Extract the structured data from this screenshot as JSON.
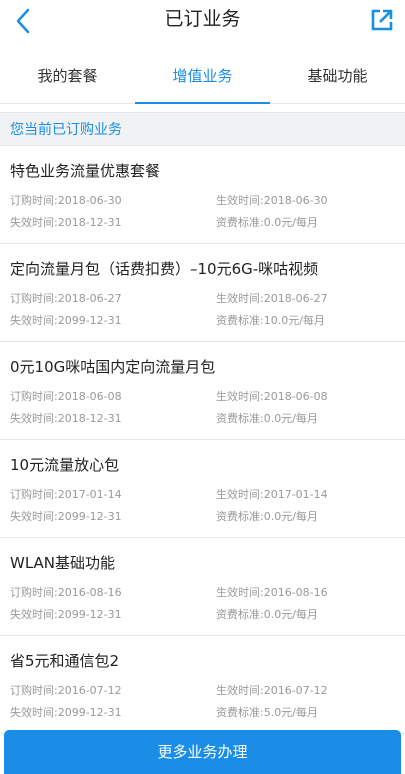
{
  "header": {
    "title": "已订业务",
    "back_icon": "chevron-left-icon",
    "share_icon": "external-link-icon",
    "accent": "#1a8ee6"
  },
  "tabs": [
    {
      "label": "我的套餐",
      "active": false
    },
    {
      "label": "增值业务",
      "active": true
    },
    {
      "label": "基础功能",
      "active": false
    }
  ],
  "section": {
    "label": "您当前已订购业务"
  },
  "items": [
    {
      "title": "特色业务流量优惠套餐",
      "order_time": "订购时间:2018-06-30",
      "effective_time": "生效时间:2018-06-30",
      "expire_time": "失效时间:2018-12-31",
      "fee": "资费标准:0.0元/每月"
    },
    {
      "title": "定向流量月包（话费扣费）–10元6G-咪咕视频",
      "order_time": "订购时间:2018-06-27",
      "effective_time": "生效时间:2018-06-27",
      "expire_time": "失效时间:2099-12-31",
      "fee": "资费标准:10.0元/每月"
    },
    {
      "title": "0元10G咪咕国内定向流量月包",
      "order_time": "订购时间:2018-06-08",
      "effective_time": "生效时间:2018-06-08",
      "expire_time": "失效时间:2018-12-31",
      "fee": "资费标准:0.0元/每月"
    },
    {
      "title": "10元流量放心包",
      "order_time": "订购时间:2017-01-14",
      "effective_time": "生效时间:2017-01-14",
      "expire_time": "失效时间:2099-12-31",
      "fee": "资费标准:0.0元/每月"
    },
    {
      "title": "WLAN基础功能",
      "order_time": "订购时间:2016-08-16",
      "effective_time": "生效时间:2016-08-16",
      "expire_time": "失效时间:2099-12-31",
      "fee": "资费标准:0.0元/每月"
    },
    {
      "title": "省5元和通信包2",
      "order_time": "订购时间:2016-07-12",
      "effective_time": "生效时间:2016-07-12",
      "expire_time": "失效时间:2099-12-31",
      "fee": "资费标准:5.0元/每月"
    }
  ],
  "footer": {
    "button_label": "更多业务办理"
  }
}
